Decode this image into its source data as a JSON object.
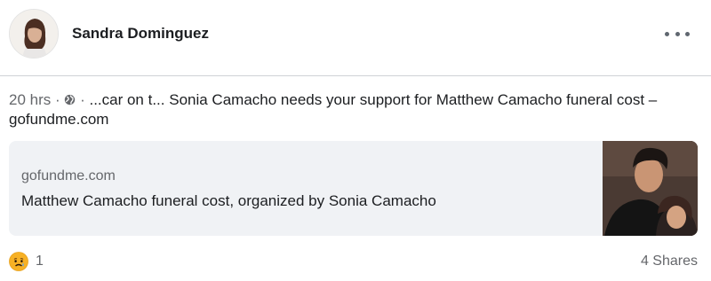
{
  "post": {
    "author_name": "Sandra Dominguez",
    "more_icon": "more-horizontal-icon",
    "timestamp": "20 hrs",
    "separator": " · ",
    "privacy_icon": "globe-icon",
    "text": "...car on t... Sonia Camacho needs your support for Matthew Camacho funeral cost – gofundme.com"
  },
  "link_preview": {
    "domain": "gofundme.com",
    "title": "Matthew Camacho funeral cost, organized by Sonia Camacho"
  },
  "footer": {
    "reaction_icon": "sad-face-icon",
    "reaction_count": "1",
    "shares_label": "4 Shares"
  },
  "colors": {
    "text_primary": "#1c1e21",
    "text_secondary": "#65676b",
    "card_background": "#f0f2f5",
    "divider": "#cfd2d6"
  }
}
